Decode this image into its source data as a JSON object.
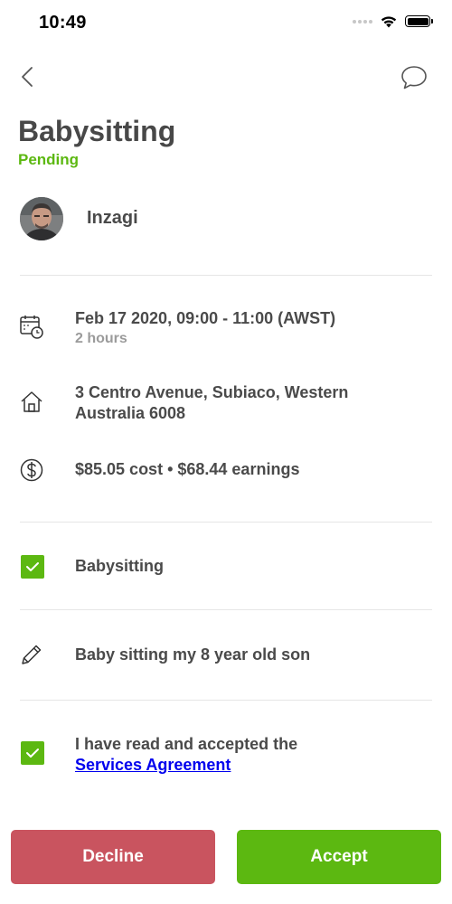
{
  "status_bar": {
    "time": "10:49",
    "icons": [
      "cellular-signal-icon",
      "wifi-icon",
      "battery-icon"
    ]
  },
  "nav": {
    "back_icon": "chevron-left-icon",
    "chat_icon": "chat-bubble-icon"
  },
  "job": {
    "title": "Babysitting",
    "status": "Pending",
    "status_color": "#5cb811"
  },
  "user": {
    "name": "Inzagi"
  },
  "details": {
    "datetime": "Feb 17 2020, 09:00 - 11:00 (AWST)",
    "duration": "2 hours",
    "address_line1": "3 Centro Avenue, Subiaco, Western",
    "address_line2": "Australia 6008",
    "pricing": "$85.05 cost • $68.44 earnings"
  },
  "services": {
    "item_label": "Babysitting",
    "checked": true
  },
  "note": {
    "text": "Baby sitting my 8 year old son"
  },
  "agreement": {
    "text": "I have read and accepted the",
    "link_label": "Services Agreement",
    "checked": true
  },
  "actions": {
    "decline_label": "Decline",
    "accept_label": "Accept",
    "decline_color": "#c9545f",
    "accept_color": "#5cb811"
  }
}
